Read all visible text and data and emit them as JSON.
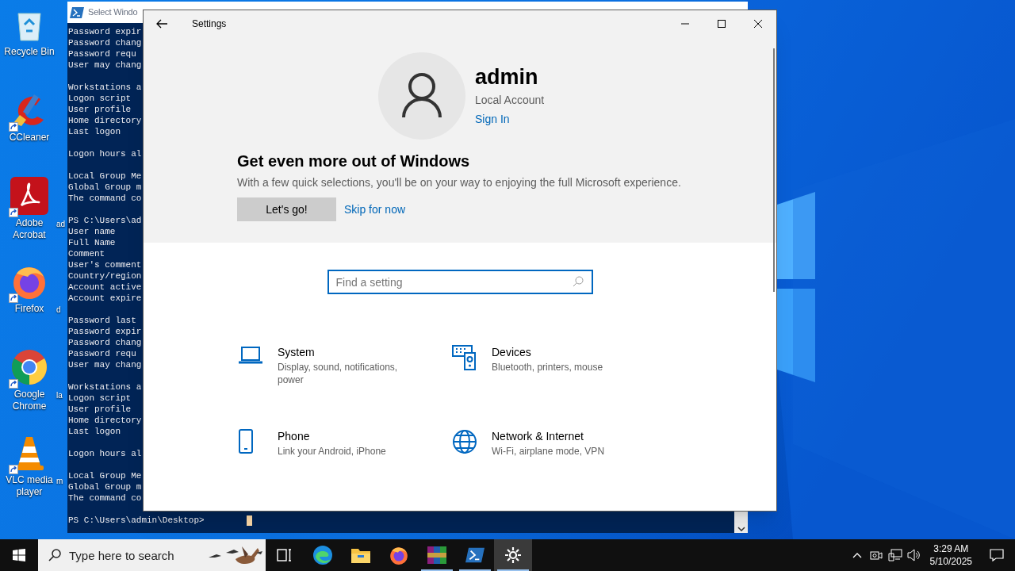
{
  "desktop": {
    "icons": [
      {
        "label": "Recycle Bin",
        "kind": "recycle",
        "shortcut": false
      },
      {
        "label": "CCleaner",
        "kind": "ccleaner",
        "shortcut": true
      },
      {
        "label": "Adobe Acrobat",
        "kind": "acrobat",
        "shortcut": true
      },
      {
        "label": "Firefox",
        "kind": "firefox",
        "shortcut": true
      },
      {
        "label": "Google Chrome",
        "kind": "chrome",
        "shortcut": true
      },
      {
        "label": "VLC media player",
        "kind": "vlc",
        "shortcut": true
      }
    ],
    "hidden_icon_labels": [
      "ad",
      "d",
      "la",
      "m"
    ]
  },
  "powershell": {
    "title": "Select Windo",
    "console_blocks": [
      [
        "Password expir",
        "Password chang",
        "Password requ",
        "User may chang"
      ],
      [
        "Workstations a",
        "Logon script",
        "User profile",
        "Home directory",
        "Last logon"
      ],
      [
        "Logon hours al"
      ],
      [
        "Local Group Me",
        "Global Group m",
        "The command co"
      ],
      [
        "PS C:\\Users\\ad",
        "User name",
        "Full Name",
        "Comment",
        "User's comment",
        "Country/region",
        "Account active",
        "Account expire"
      ],
      [
        "Password last",
        "Password expir",
        "Password chang",
        "Password requ",
        "User may chang"
      ],
      [
        "Workstations a",
        "Logon script",
        "User profile",
        "Home directory",
        "Last logon"
      ],
      [
        "Logon hours al"
      ],
      [
        "Local Group Me",
        "Global Group m",
        "The command co"
      ]
    ],
    "prompt": "PS C:\\Users\\admin\\Desktop>"
  },
  "settings": {
    "window": {
      "title": "Settings"
    },
    "account": {
      "name": "admin",
      "type": "Local Account",
      "sign_in": "Sign In"
    },
    "promo": {
      "heading": "Get even more out of Windows",
      "text": "With a few quick selections, you'll be on your way to enjoying the full Microsoft experience.",
      "primary_button": "Let's go!",
      "secondary_link": "Skip for now"
    },
    "search": {
      "placeholder": "Find a setting"
    },
    "categories": [
      {
        "kind": "laptop",
        "title": "System",
        "subtitle": "Display, sound, notifications, power"
      },
      {
        "kind": "devices",
        "title": "Devices",
        "subtitle": "Bluetooth, printers, mouse"
      },
      {
        "kind": "phone",
        "title": "Phone",
        "subtitle": "Link your Android, iPhone"
      },
      {
        "kind": "globe",
        "title": "Network & Internet",
        "subtitle": "Wi-Fi, airplane mode, VPN"
      }
    ]
  },
  "taskbar": {
    "search_placeholder": "Type here to search",
    "apps": [
      {
        "kind": "taskview",
        "running": false,
        "selected": false
      },
      {
        "kind": "edge",
        "running": false,
        "selected": false
      },
      {
        "kind": "explorer",
        "running": false,
        "selected": false
      },
      {
        "kind": "firefox",
        "running": false,
        "selected": false
      },
      {
        "kind": "winrar",
        "running": true,
        "selected": false
      },
      {
        "kind": "powershell",
        "running": true,
        "selected": false
      },
      {
        "kind": "settings",
        "running": true,
        "selected": true
      }
    ],
    "time": "3:29 AM",
    "date": "5/10/2025"
  }
}
